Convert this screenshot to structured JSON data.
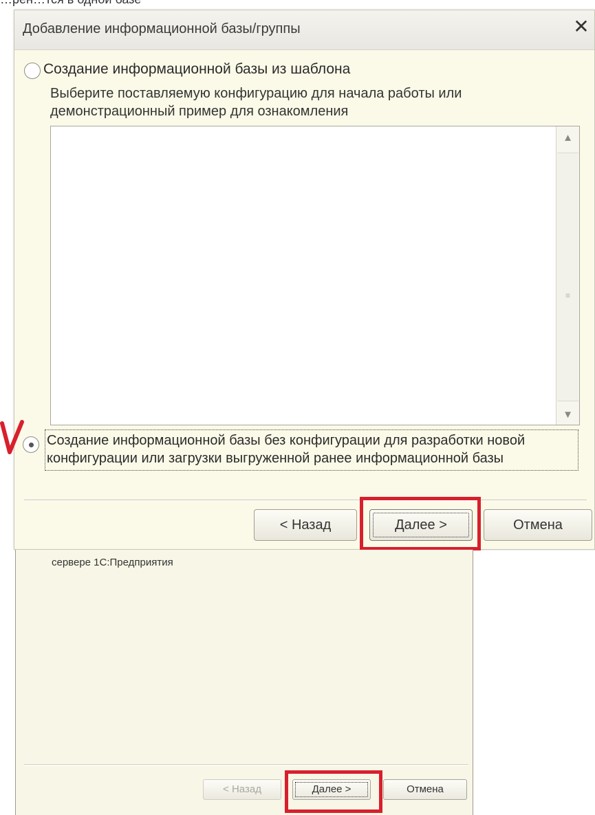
{
  "top_cut_text": "…рен…тся в одной базе",
  "dialog": {
    "title": "Добавление информационной базы/группы",
    "close_glyph": "✕",
    "option_template_label": "Создание информационной базы из шаблона",
    "option_template_selected": false,
    "template_description": "Выберите поставляемую конфигурацию для начала работы или демонстрационный пример для ознакомления",
    "template_list_items": [],
    "option_empty_label": "Создание информационной базы без конфигурации для разработки новой конфигурации или загрузки выгруженной ранее информационной базы",
    "option_empty_selected": true,
    "buttons": {
      "back": "< Назад",
      "next": "Далее >",
      "cancel": "Отмена"
    }
  },
  "second_dialog": {
    "text": "сервере 1С:Предприятия",
    "buttons": {
      "back": "< Назад",
      "next": "Далее >",
      "cancel": "Отмена"
    },
    "back_disabled": true
  },
  "annotations": {
    "highlight_color": "#d8202d",
    "checkmark_color": "#d8202d"
  },
  "colors": {
    "dialog_bg": "#fbfae8",
    "button_border": "#9f9c90"
  },
  "icons": {
    "scroll_up": "scroll-up-arrow-icon",
    "scroll_down": "scroll-down-arrow-icon",
    "checkmark": "red-checkmark-icon"
  }
}
